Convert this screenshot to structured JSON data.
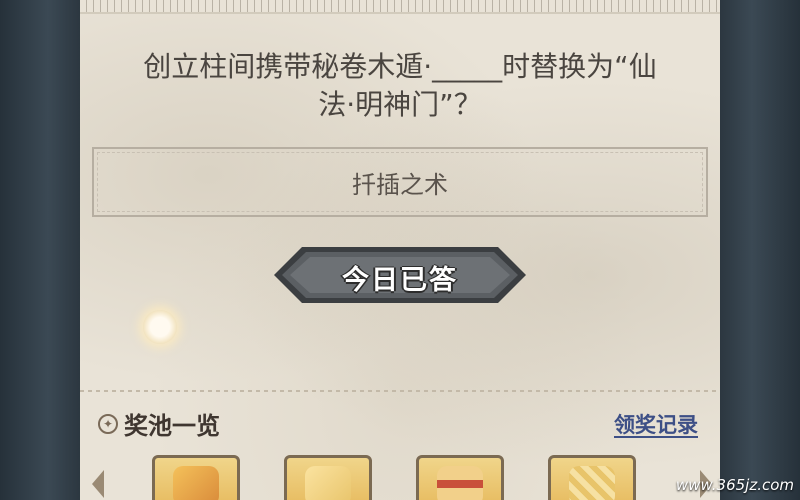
{
  "question": {
    "line1": "创立柱间携带秘卷木遁·_____时替换为“仙",
    "line2": "法·明神门”？"
  },
  "answer": {
    "text": "扦插之术"
  },
  "status_button": {
    "label": "今日已答"
  },
  "reward_pool": {
    "title": "奖池一览",
    "record_link": "领奖记录",
    "items": [
      {
        "icon": "treasure-bag-icon",
        "color": "#d98a3a"
      },
      {
        "icon": "scroll-bundle-icon",
        "color": "#e8c46a"
      },
      {
        "icon": "ribbon-gift-icon",
        "color": "#c9503a"
      },
      {
        "icon": "scroll-roll-icon",
        "color": "#eed28a"
      }
    ]
  },
  "watermark": "www.365jz.com",
  "colors": {
    "paper": "#e9e3d7",
    "button_dark": "#4a4d50",
    "link": "#3d4f86"
  }
}
